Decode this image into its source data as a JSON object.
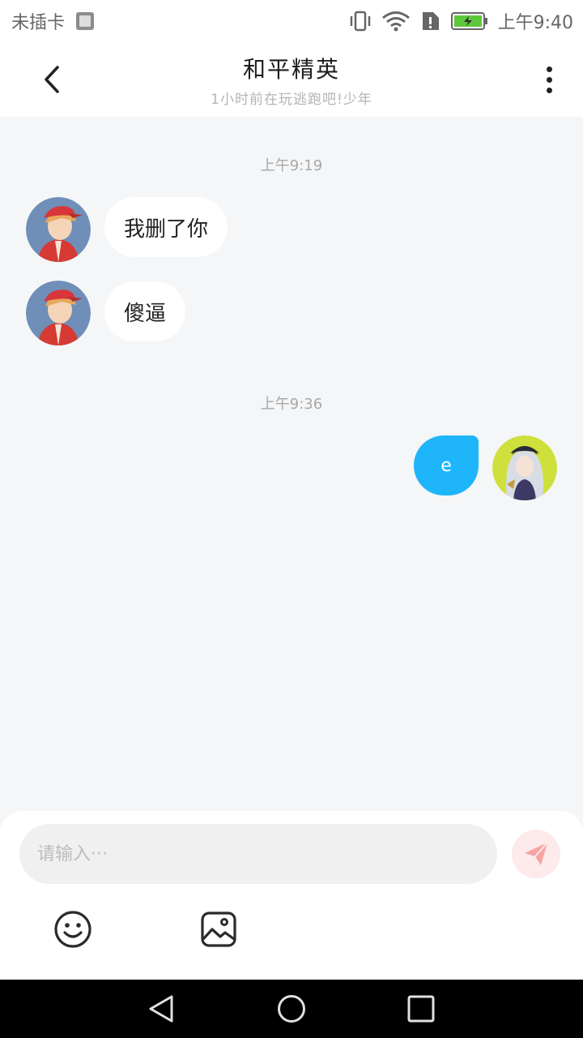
{
  "status_bar": {
    "carrier": "未插卡",
    "time": "上午9:40",
    "icons": [
      "image-indicator-icon",
      "vibrate-icon",
      "wifi-icon",
      "sim-alert-icon",
      "battery-charging-icon"
    ]
  },
  "header": {
    "title": "和平精英",
    "subtitle": "1小时前在玩逃跑吧!少年",
    "back_icon": "chevron-left-icon",
    "more_icon": "more-vertical-icon"
  },
  "messages": [
    {
      "type": "timestamp",
      "text": "上午9:19"
    },
    {
      "type": "message",
      "from": "other",
      "avatar": "avatar-red-cap-boy",
      "text": "我删了你"
    },
    {
      "type": "message",
      "from": "other",
      "avatar": "avatar-red-cap-boy",
      "text": "傻逼"
    },
    {
      "type": "timestamp",
      "text": "上午9:36"
    },
    {
      "type": "message",
      "from": "me",
      "avatar": "avatar-anime-girl",
      "text": "e"
    }
  ],
  "input": {
    "placeholder": "请输入···",
    "value": "",
    "send_icon": "paper-plane-icon"
  },
  "toolbar": {
    "emoji_icon": "emoji-icon",
    "image_icon": "image-icon"
  },
  "colors": {
    "my_bubble": "#1fb5fa",
    "chat_bg": "#f5f6f8",
    "send_button_bg": "#fdeaea",
    "send_icon": "#f6a4a4",
    "battery": "#5ec83c"
  },
  "nav_bar": {
    "icons": [
      "back-triangle-icon",
      "home-circle-icon",
      "recents-square-icon"
    ]
  }
}
